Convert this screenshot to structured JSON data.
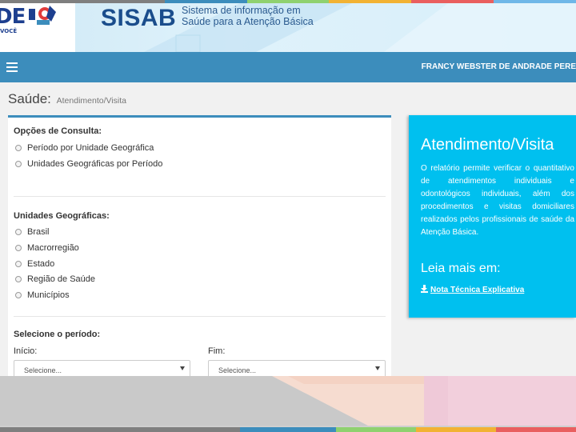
{
  "colors": {
    "navbar": "#3c8dbc",
    "info_box": "#00c0ef",
    "header_bg": "#d7eef9",
    "logo_blue": "#1d3f8f",
    "strip": [
      "#7f7f7f",
      "#3c8dbc",
      "#8fd16f",
      "#f2b233",
      "#e95f5f",
      "#6fb7e8"
    ]
  },
  "header": {
    "logo_text": "DE",
    "logo_subtext": "VOCÊ",
    "app_name": "SISAB",
    "app_subtitle_line1": "Sistema de informação em",
    "app_subtitle_line2": "Saúde para a Atenção Básica"
  },
  "navbar": {
    "menu_icon": "hamburger-icon",
    "user_name": "FRANCY WEBSTER DE ANDRADE PERE"
  },
  "page": {
    "title": "Saúde:",
    "subtitle": "Atendimento/Visita"
  },
  "form": {
    "consulta_title": "Opções de Consulta:",
    "consulta_options": [
      "Período por Unidade Geográfica",
      "Unidades Geográficas por Período"
    ],
    "unidades_title": "Unidades Geográficas:",
    "unidades_options": [
      "Brasil",
      "Macrorregião",
      "Estado",
      "Região de Saúde",
      "Municípios"
    ],
    "periodo_title": "Selecione o período:",
    "inicio_label": "Início:",
    "fim_label": "Fim:",
    "inicio_select": "Selecione...",
    "fim_select": "Selecione..."
  },
  "info": {
    "title": "Atendimento/Visita",
    "description": "O relatório permite verificar o quantitativo de atendimentos individuais e odontológicos individuais, além dos procedimentos e visitas domiciliares realizados pelos profissionais de saúde da Atenção Básica.",
    "read_more": "Leia mais em:",
    "link_icon": "download-icon",
    "link_text": "Nota Técnica Explicativa"
  }
}
